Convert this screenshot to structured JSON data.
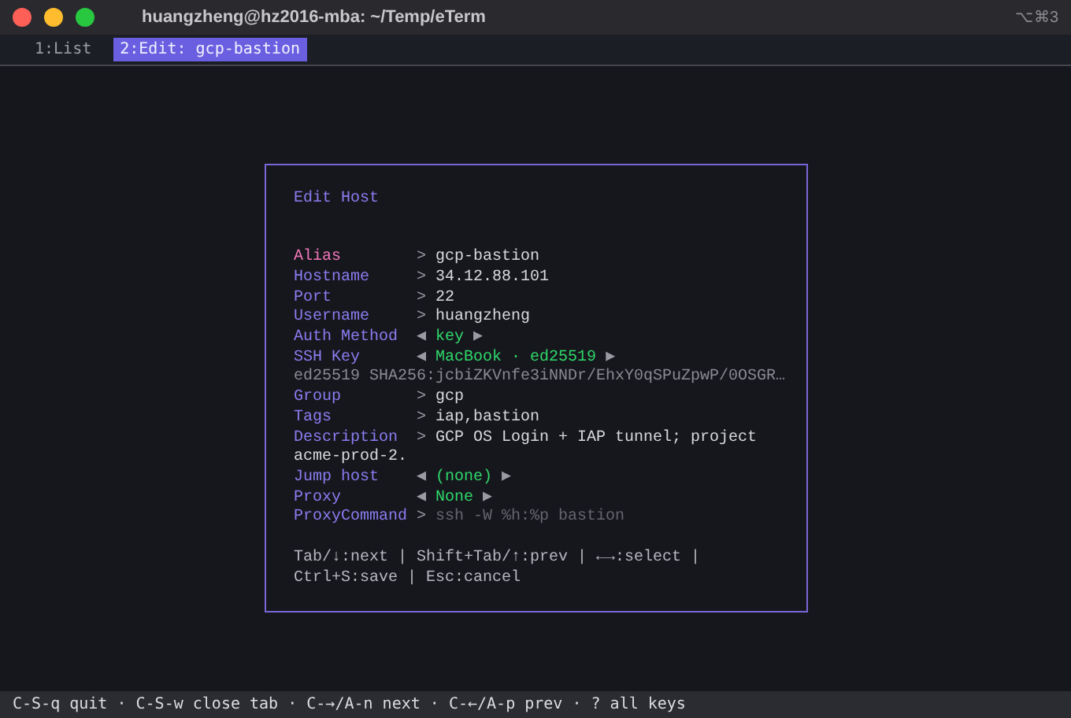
{
  "window": {
    "title": "huangzheng@hz2016-mba: ~/Temp/eTerm",
    "shortcut": "⌥⌘3"
  },
  "tabs": [
    {
      "label": "1:List",
      "selected": false
    },
    {
      "label": "2:Edit: gcp-bastion",
      "selected": true
    }
  ],
  "dialog": {
    "title": "Edit Host",
    "fields": [
      {
        "kind": "input",
        "label": "Alias",
        "prompt": ">",
        "value": "gcp-bastion",
        "selected": true
      },
      {
        "kind": "input",
        "label": "Hostname",
        "prompt": ">",
        "value": "34.12.88.101",
        "selected": false
      },
      {
        "kind": "input",
        "label": "Port",
        "prompt": ">",
        "value": "22",
        "selected": false
      },
      {
        "kind": "input",
        "label": "Username",
        "prompt": ">",
        "value": "huangzheng",
        "selected": false
      },
      {
        "kind": "select",
        "label": "Auth Method",
        "left": "◀",
        "value": "key",
        "right": "▶",
        "selected": false
      },
      {
        "kind": "select",
        "label": "SSH Key",
        "left": "◀",
        "value": "MacBook · ed25519",
        "right": "▶",
        "selected": false
      },
      {
        "kind": "note",
        "value": "ed25519 SHA256:jcbiZKVnfe3iNNDr/EhxY0qSPuZpwP/0OSGR…"
      },
      {
        "kind": "input",
        "label": "Group",
        "prompt": ">",
        "value": "gcp",
        "selected": false
      },
      {
        "kind": "input",
        "label": "Tags",
        "prompt": ">",
        "value": "iap,bastion",
        "selected": false
      },
      {
        "kind": "input",
        "label": "Description",
        "prompt": ">",
        "value": "GCP OS Login + IAP tunnel; project",
        "continuation": "acme-prod-2.",
        "selected": false
      },
      {
        "kind": "select",
        "label": "Jump host",
        "left": "◀",
        "value": "(none)",
        "right": "▶",
        "selected": false
      },
      {
        "kind": "select",
        "label": "Proxy",
        "left": "◀",
        "value": "None",
        "right": "▶",
        "selected": false
      },
      {
        "kind": "input",
        "label": "ProxyCommand",
        "prompt": ">",
        "placeholder": "ssh -W %h:%p bastion",
        "selected": false
      }
    ],
    "help": "Tab/↓:next | Shift+Tab/↑:prev | ←→:select | Ctrl+S:save | Esc:cancel"
  },
  "status_bar": "C-S-q quit · C-S-w close tab · C-→/A-n next · C-←/A-p prev · ? all keys"
}
